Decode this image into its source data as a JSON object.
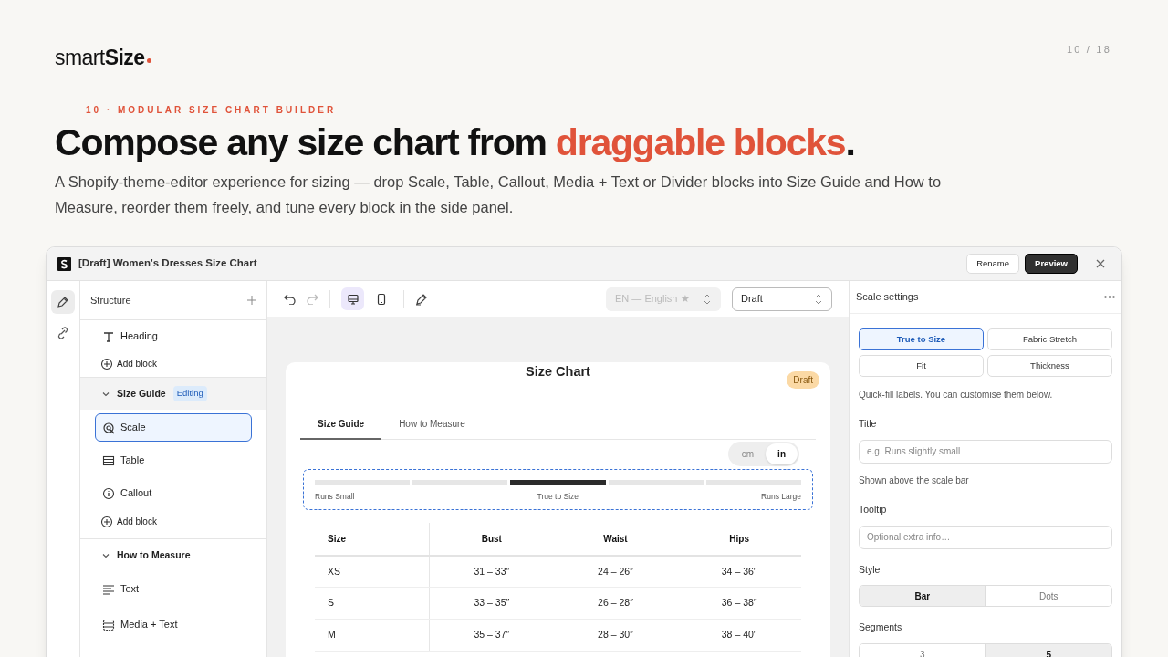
{
  "brand": {
    "logo": "smart**Size**",
    "page": "10 / 18"
  },
  "eyebrow": "10 · MODULAR SIZE CHART BUILDER",
  "headline": [
    {
      "text": "Compose any size chart from ",
      "accent": false
    },
    {
      "text": "draggable blocks",
      "accent": true
    },
    {
      "text": ".",
      "accent": false
    }
  ],
  "intro": "A Shopify-theme-editor experience for sizing — drop Scale, Table, Callout, Media + Text or Divider blocks into Size Guide and How to Measure, reorder them freely, and tune every block in the side panel.",
  "window": {
    "title": "[Draft] Women's Dresses Size Chart",
    "buttons": [
      {
        "label": "Rename",
        "primary": false
      },
      {
        "label": "Preview",
        "primary": true
      }
    ]
  },
  "rail": [
    {
      "kind": "edit",
      "selected": true
    },
    {
      "kind": "link",
      "selected": false
    }
  ],
  "structure": {
    "title": "Structure",
    "items": [
      {
        "kind": "heading",
        "label": "Heading"
      },
      {
        "kind": "add",
        "label": "Add block"
      },
      {
        "kind": "section",
        "label": "Size Guide",
        "badge": "Editing",
        "expanded": true,
        "children": [
          {
            "kind": "scale",
            "label": "Scale",
            "selected": true
          },
          {
            "kind": "table",
            "label": "Table",
            "selected": false
          },
          {
            "kind": "callout",
            "label": "Callout",
            "selected": false
          },
          {
            "kind": "add",
            "label": "Add block"
          }
        ]
      },
      {
        "kind": "section",
        "label": "How to Measure",
        "expanded": true,
        "children": [
          {
            "kind": "text",
            "label": "Text",
            "selected": false
          },
          {
            "kind": "media",
            "label": "Media + Text",
            "selected": false
          }
        ]
      }
    ]
  },
  "toolbar": {
    "devices": [
      {
        "kind": "desktop",
        "selected": true
      },
      {
        "kind": "mobile",
        "selected": false
      }
    ],
    "language": {
      "value": "EN — English ★",
      "disabled": true
    },
    "status": {
      "value": "Draft"
    }
  },
  "preview": {
    "badge": "Draft",
    "title": "Size Chart",
    "tabs": [
      {
        "label": "Size Guide",
        "selected": true
      },
      {
        "label": "How to Measure",
        "selected": false
      }
    ],
    "units": [
      {
        "label": "cm",
        "selected": false
      },
      {
        "label": "in",
        "selected": true
      }
    ],
    "scale": {
      "segments": [
        {
          "selected": false
        },
        {
          "selected": false
        },
        {
          "selected": true
        },
        {
          "selected": false
        },
        {
          "selected": false
        }
      ],
      "labels": [
        "Runs Small",
        "True to Size",
        "Runs Large"
      ]
    },
    "table": {
      "columns": [
        "Size",
        "Bust",
        "Waist",
        "Hips"
      ],
      "rows": [
        [
          "XS",
          "31 – 33″",
          "24 – 26″",
          "34 – 36″"
        ],
        [
          "S",
          "33 – 35″",
          "26 – 28″",
          "36 – 38″"
        ],
        [
          "M",
          "35 – 37″",
          "28 – 30″",
          "38 – 40″"
        ]
      ]
    }
  },
  "settings": {
    "title": "Scale settings",
    "presets": [
      {
        "label": "True to Size",
        "selected": true
      },
      {
        "label": "Fabric Stretch",
        "selected": false
      },
      {
        "label": "Fit",
        "selected": false
      },
      {
        "label": "Thickness",
        "selected": false
      }
    ],
    "preset_note": "Quick-fill labels. You can customise them below.",
    "title_field": {
      "label": "Title",
      "placeholder": "e.g. Runs slightly small",
      "help": "Shown above the scale bar"
    },
    "tooltip_field": {
      "label": "Tooltip",
      "placeholder": "Optional extra info…"
    },
    "style": {
      "label": "Style",
      "options": [
        {
          "label": "Bar",
          "selected": true
        },
        {
          "label": "Dots",
          "selected": false
        }
      ]
    },
    "segments": {
      "label": "Segments",
      "options": [
        {
          "label": "3",
          "selected": false
        },
        {
          "label": "5",
          "selected": true
        }
      ]
    }
  }
}
